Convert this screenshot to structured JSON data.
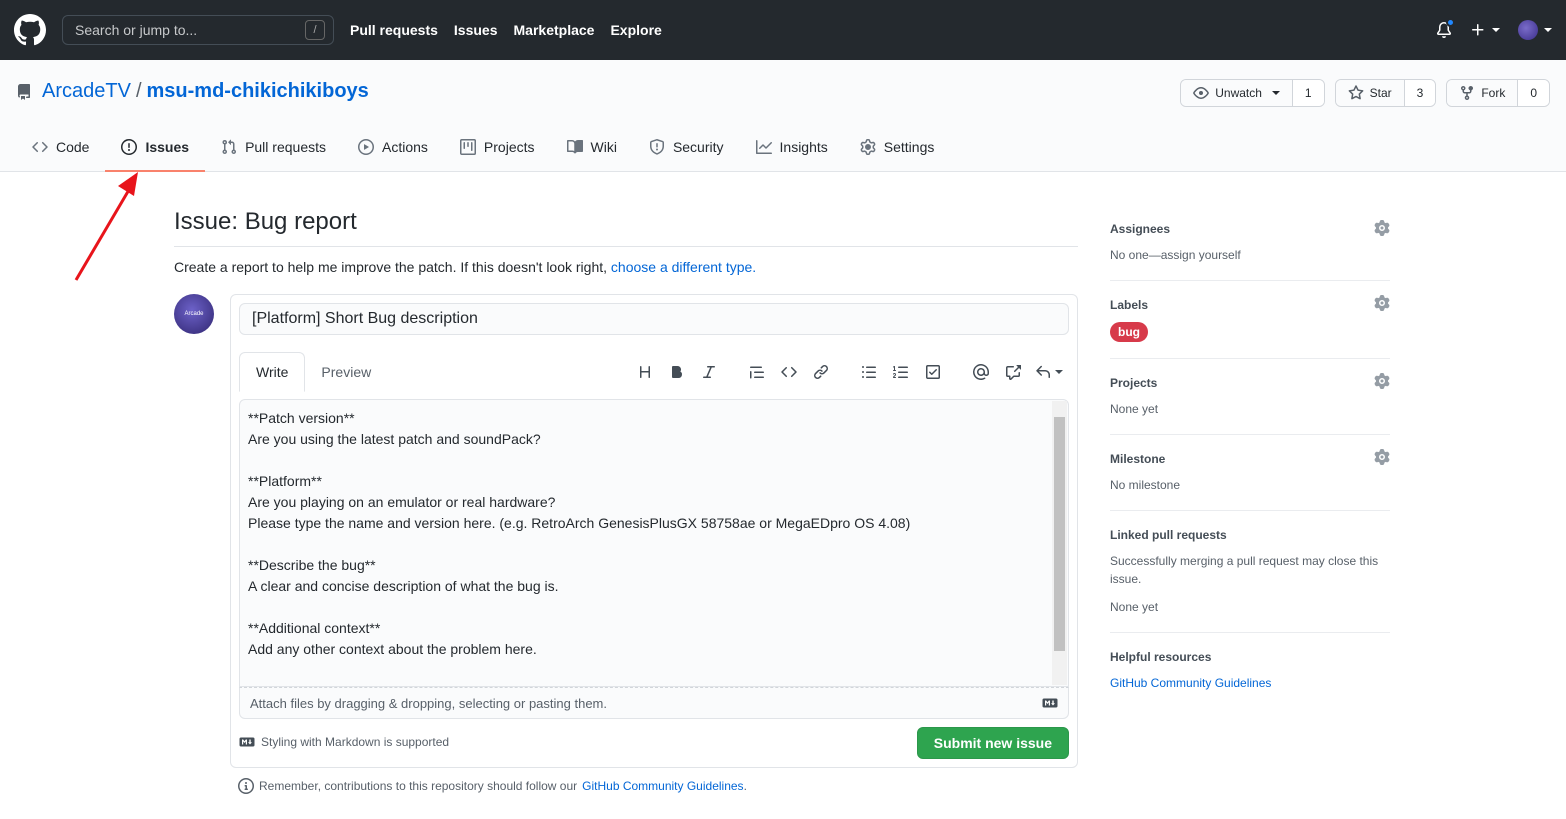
{
  "header": {
    "search_placeholder": "Search or jump to...",
    "slash_key": "/",
    "nav": [
      "Pull requests",
      "Issues",
      "Marketplace",
      "Explore"
    ]
  },
  "repo": {
    "owner": "ArcadeTV",
    "separator": "/",
    "name": "msu-md-chikichikiboys",
    "watch_label": "Unwatch",
    "watch_count": "1",
    "star_label": "Star",
    "star_count": "3",
    "fork_label": "Fork",
    "fork_count": "0",
    "tabs": [
      {
        "label": "Code",
        "icon": "code-icon"
      },
      {
        "label": "Issues",
        "icon": "issue-icon"
      },
      {
        "label": "Pull requests",
        "icon": "pull-request-icon"
      },
      {
        "label": "Actions",
        "icon": "play-icon"
      },
      {
        "label": "Projects",
        "icon": "project-icon"
      },
      {
        "label": "Wiki",
        "icon": "book-icon"
      },
      {
        "label": "Security",
        "icon": "shield-icon"
      },
      {
        "label": "Insights",
        "icon": "graph-icon"
      },
      {
        "label": "Settings",
        "icon": "gear-icon"
      }
    ]
  },
  "issue": {
    "heading_prefix": "Issue:",
    "heading": "Bug report",
    "subtitle": "Create a report to help me improve the patch. If this doesn't look right,",
    "subtitle_link": "choose a different type.",
    "avatar_text": "Arcade",
    "title_value": "[Platform] Short Bug description",
    "tab_write": "Write",
    "tab_preview": "Preview",
    "body_lines": [
      "**Patch version**",
      "Are you using the latest patch and soundPack?",
      "",
      "**Platform**",
      "Are you playing on an emulator or real hardware?",
      "Please type the name and version here. (e.g. RetroArch GenesisPlusGX 58758ae or MegaEDpro OS 4.08)",
      "",
      "**Describe the bug**",
      "A clear and concise description of what the bug is.",
      "",
      "**Additional context**",
      "Add any other context about the problem here."
    ],
    "attach_text": "Attach files by dragging & dropping, selecting or pasting them.",
    "markdown_note": "Styling with Markdown is supported",
    "submit_label": "Submit new issue",
    "remember_text": "Remember, contributions to this repository should follow our",
    "remember_link": "GitHub Community Guidelines",
    "remember_end": "."
  },
  "sidebar": {
    "assignees_title": "Assignees",
    "assignees_value": "No one—assign yourself",
    "labels_title": "Labels",
    "label_bug": "bug",
    "projects_title": "Projects",
    "projects_value": "None yet",
    "milestone_title": "Milestone",
    "milestone_value": "No milestone",
    "linked_title": "Linked pull requests",
    "linked_desc": "Successfully merging a pull request may close this issue.",
    "linked_value": "None yet",
    "helpful_title": "Helpful resources",
    "helpful_link": "GitHub Community Guidelines"
  },
  "colors": {
    "header_bg": "#24292e",
    "link": "#0366d6",
    "submit_green": "#2ea44f",
    "bug_label": "#d73a4a",
    "selected_tab_underline": "#f9826c",
    "annotation_arrow": "#e8141b"
  }
}
